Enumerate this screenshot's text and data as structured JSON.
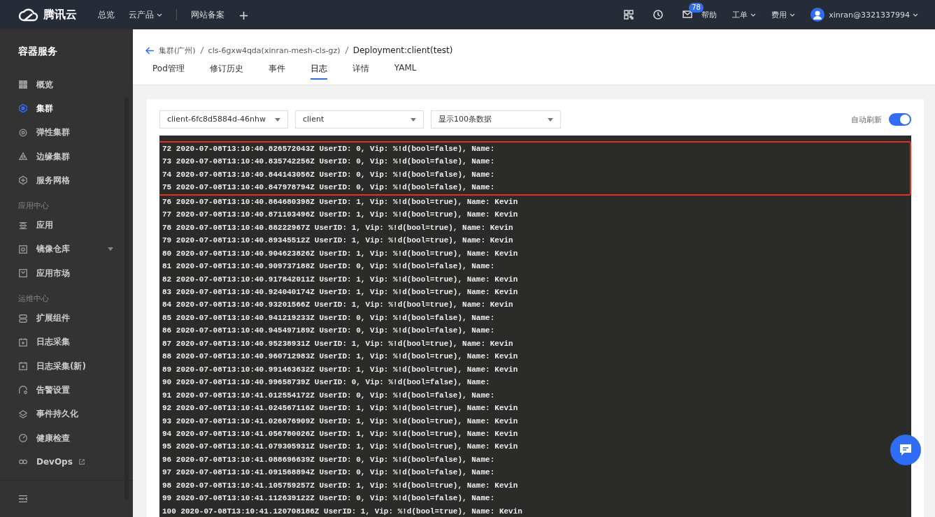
{
  "topbar": {
    "brand": "腾讯云",
    "nav": [
      {
        "label": "总览",
        "dropdown": false
      },
      {
        "label": "云产品",
        "dropdown": true
      },
      {
        "label": "网站备案",
        "dropdown": false
      },
      {
        "label": "+",
        "dropdown": false
      }
    ],
    "mail_badge": "78",
    "links": [
      {
        "label": "帮助",
        "dropdown": false
      },
      {
        "label": "工单",
        "dropdown": true
      },
      {
        "label": "费用",
        "dropdown": true
      }
    ],
    "user": "xinran@3321337994"
  },
  "sidebar": {
    "title": "容器服务",
    "sections": [
      {
        "items": [
          {
            "label": "概览",
            "selected": false
          },
          {
            "label": "集群",
            "selected": true
          },
          {
            "label": "弹性集群",
            "selected": false
          },
          {
            "label": "边缘集群",
            "selected": false
          },
          {
            "label": "服务网格",
            "selected": false
          }
        ]
      },
      {
        "title": "应用中心",
        "items": [
          {
            "label": "应用",
            "selected": false
          },
          {
            "label": "镜像仓库",
            "selected": false,
            "expandable": true
          },
          {
            "label": "应用市场",
            "selected": false
          }
        ]
      },
      {
        "title": "运维中心",
        "items": [
          {
            "label": "扩展组件",
            "selected": false
          },
          {
            "label": "日志采集",
            "selected": false
          },
          {
            "label": "日志采集(新)",
            "selected": false
          },
          {
            "label": "告警设置",
            "selected": false
          },
          {
            "label": "事件持久化",
            "selected": false
          },
          {
            "label": "健康检查",
            "selected": false
          },
          {
            "label": "DevOps",
            "selected": false,
            "external": true
          }
        ]
      }
    ]
  },
  "breadcrumb": [
    "集群(广州)",
    "cls-6gxw4qda(xinran-mesh-cls-gz)",
    "Deployment:client(test)"
  ],
  "tabs": [
    {
      "label": "Pod管理",
      "selected": false
    },
    {
      "label": "修订历史",
      "selected": false
    },
    {
      "label": "事件",
      "selected": false
    },
    {
      "label": "日志",
      "selected": true
    },
    {
      "label": "详情",
      "selected": false
    },
    {
      "label": "YAML",
      "selected": false
    }
  ],
  "selects": [
    "client-6fc8d5884d-46nhw",
    "client",
    "显示100条数据"
  ],
  "auto_refresh": {
    "label": "自动刷新",
    "on": true
  },
  "log_lines": [
    {
      "text": "72 2020-07-08T13:10:40.826572043Z UserID: 0, Vip: %!d(bool=false), Name:",
      "highlighted": true
    },
    {
      "text": "73 2020-07-08T13:10:40.835742256Z UserID: 0, Vip: %!d(bool=false), Name:",
      "highlighted": true
    },
    {
      "text": "74 2020-07-08T13:10:40.844143056Z UserID: 0, Vip: %!d(bool=false), Name:",
      "highlighted": true
    },
    {
      "text": "75 2020-07-08T13:10:40.847978794Z UserID: 0, Vip: %!d(bool=false), Name:",
      "highlighted": true
    },
    {
      "text": "76 2020-07-08T13:10:40.864680398Z UserID: 1, Vip: %!d(bool=true), Name: Kevin",
      "highlighted": false
    },
    {
      "text": "77 2020-07-08T13:10:40.871103496Z UserID: 1, Vip: %!d(bool=true), Name: Kevin",
      "highlighted": false
    },
    {
      "text": "78 2020-07-08T13:10:40.88222967Z UserID: 1, Vip: %!d(bool=true), Name: Kevin",
      "highlighted": false
    },
    {
      "text": "79 2020-07-08T13:10:40.89345512Z UserID: 1, Vip: %!d(bool=true), Name: Kevin",
      "highlighted": false
    },
    {
      "text": "80 2020-07-08T13:10:40.904623826Z UserID: 1, Vip: %!d(bool=true), Name: Kevin",
      "highlighted": false
    },
    {
      "text": "81 2020-07-08T13:10:40.909737188Z UserID: 0, Vip: %!d(bool=false), Name:",
      "highlighted": false
    },
    {
      "text": "82 2020-07-08T13:10:40.917842011Z UserID: 1, Vip: %!d(bool=true), Name: Kevin",
      "highlighted": false
    },
    {
      "text": "83 2020-07-08T13:10:40.924040174Z UserID: 1, Vip: %!d(bool=true), Name: Kevin",
      "highlighted": false
    },
    {
      "text": "84 2020-07-08T13:10:40.93201566Z UserID: 1, Vip: %!d(bool=true), Name: Kevin",
      "highlighted": false
    },
    {
      "text": "85 2020-07-08T13:10:40.941219233Z UserID: 0, Vip: %!d(bool=false), Name:",
      "highlighted": false
    },
    {
      "text": "86 2020-07-08T13:10:40.945497189Z UserID: 0, Vip: %!d(bool=false), Name:",
      "highlighted": false
    },
    {
      "text": "87 2020-07-08T13:10:40.95238931Z UserID: 1, Vip: %!d(bool=true), Name: Kevin",
      "highlighted": false
    },
    {
      "text": "88 2020-07-08T13:10:40.960712983Z UserID: 1, Vip: %!d(bool=true), Name: Kevin",
      "highlighted": false
    },
    {
      "text": "89 2020-07-08T13:10:40.991463632Z UserID: 1, Vip: %!d(bool=true), Name: Kevin",
      "highlighted": false
    },
    {
      "text": "90 2020-07-08T13:10:40.99658739Z UserID: 0, Vip: %!d(bool=false), Name:",
      "highlighted": false
    },
    {
      "text": "91 2020-07-08T13:10:41.012554172Z UserID: 0, Vip: %!d(bool=false), Name:",
      "highlighted": false
    },
    {
      "text": "92 2020-07-08T13:10:41.024567116Z UserID: 1, Vip: %!d(bool=true), Name: Kevin",
      "highlighted": false
    },
    {
      "text": "93 2020-07-08T13:10:41.026676909Z UserID: 1, Vip: %!d(bool=true), Name: Kevin",
      "highlighted": false
    },
    {
      "text": "94 2020-07-08T13:10:41.056780026Z UserID: 1, Vip: %!d(bool=true), Name: Kevin",
      "highlighted": false
    },
    {
      "text": "95 2020-07-08T13:10:41.079305931Z UserID: 1, Vip: %!d(bool=true), Name: Kevin",
      "highlighted": false
    },
    {
      "text": "96 2020-07-08T13:10:41.088696639Z UserID: 0, Vip: %!d(bool=false), Name:",
      "highlighted": false
    },
    {
      "text": "97 2020-07-08T13:10:41.091568894Z UserID: 0, Vip: %!d(bool=false), Name:",
      "highlighted": false
    },
    {
      "text": "98 2020-07-08T13:10:41.105759257Z UserID: 1, Vip: %!d(bool=true), Name: Kevin",
      "highlighted": false
    },
    {
      "text": "99 2020-07-08T13:10:41.112639122Z UserID: 0, Vip: %!d(bool=false), Name:",
      "highlighted": false
    },
    {
      "text": "100 2020-07-08T13:10:41.120708186Z UserID: 1, Vip: %!d(bool=true), Name: Kevin",
      "highlighted": false
    }
  ]
}
